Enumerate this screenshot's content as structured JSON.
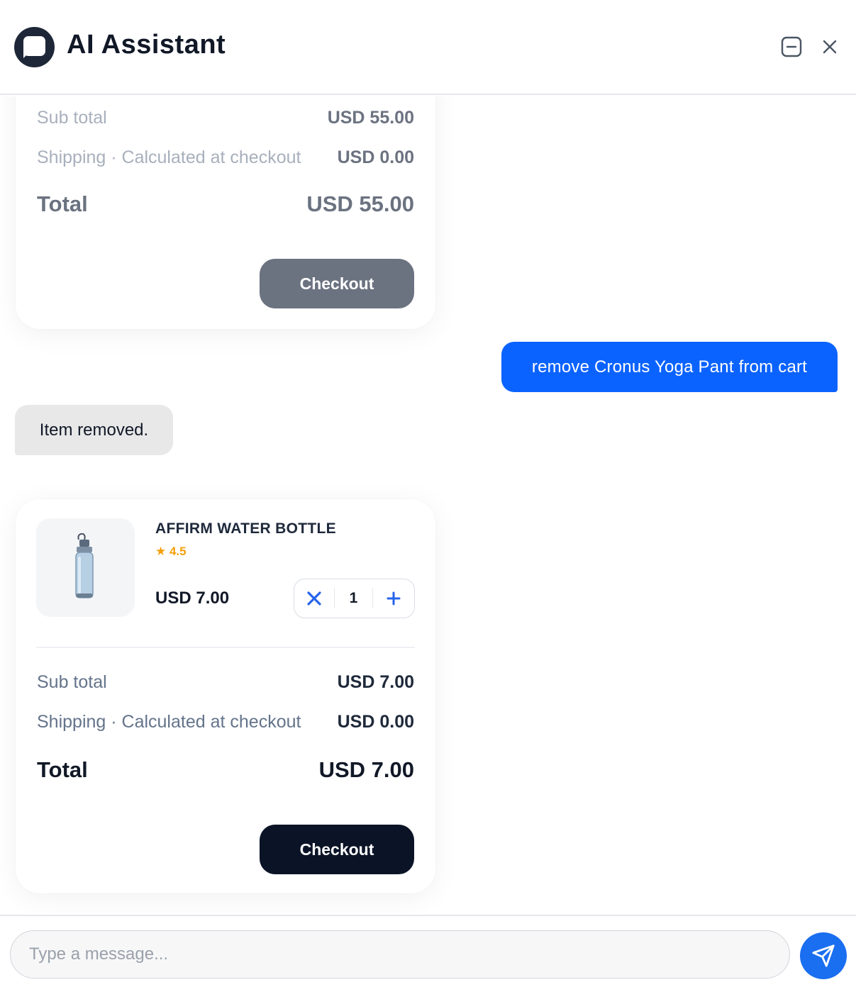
{
  "header": {
    "title": "AI Assistant",
    "logo_icon": "chat-bubble-icon",
    "minimize_icon": "minimize-icon",
    "close_icon": "close-icon"
  },
  "previous_cart": {
    "subtotal_label": "Sub total",
    "subtotal_value": "USD 55.00",
    "shipping_label": "Shipping · Calculated at checkout",
    "shipping_value": "USD 0.00",
    "total_label": "Total",
    "total_value": "USD 55.00",
    "checkout_label": "Checkout",
    "checkout_color": "#6b7280"
  },
  "messages": {
    "user": "remove Cronus Yoga Pant from cart",
    "bot": "Item removed.",
    "user_color": "#0b63ff"
  },
  "current_cart": {
    "item": {
      "name": "AFFIRM WATER BOTTLE",
      "rating": "★ 4.5",
      "price": "USD 7.00",
      "quantity": "1",
      "remove_icon": "remove-icon",
      "add_icon": "plus-icon",
      "image_icon": "water-bottle-image"
    },
    "subtotal_label": "Sub total",
    "subtotal_value": "USD 7.00",
    "shipping_label": "Shipping · Calculated at checkout",
    "shipping_value": "USD 0.00",
    "total_label": "Total",
    "total_value": "USD 7.00",
    "checkout_label": "Checkout",
    "checkout_color": "#0b1427"
  },
  "composer": {
    "placeholder": "Type a message...",
    "send_icon": "send-icon",
    "send_color": "#1a6ef0"
  }
}
